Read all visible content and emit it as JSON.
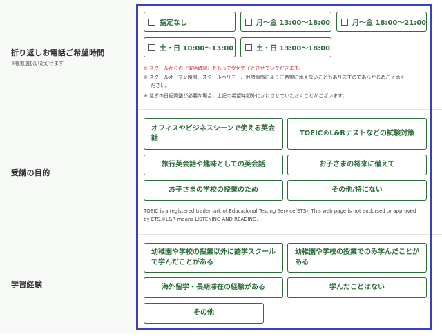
{
  "callback": {
    "label": "折り返しお電話ご希望時間",
    "sublabel": "※複数選択いただけます",
    "options": [
      "指定なし",
      "月〜金 13:00〜18:00",
      "月〜金 18:00〜21:00",
      "土・日 10:00〜13:00",
      "土・日 13:00〜18:00"
    ],
    "notes": [
      "※ スクールからの『電話確認』をもって受付完了とさせていただきます。",
      "※ スクールオープン時間、スクールホリデー、他諸事情によりご希望に添えないこともありますのであらかじめご了承く",
      "ださい。",
      "※ 急ぎの日程調整が必要な場合、上記の希望時間外にかけさせていただくことがございます。"
    ]
  },
  "purpose": {
    "label": "受講の目的",
    "options": [
      "オフィスやビジネスシーンで使える英会話",
      "TOEIC®L&Rテストなどの試験対策",
      "旅行英会話や趣味としての英会話",
      "お子さまの将来に備えて",
      "お子さまの学校の授業のため",
      "その他/特にない"
    ],
    "trademark": "TOEIC is a registered trademark of Educational Testing Service(ETS). This web page is not endorsed or approved by ETS.※L&R means LISTENING AND READING."
  },
  "experience": {
    "label": "学習経験",
    "options": [
      "幼稚園や学校の授業以外に語学スクールで学んだことがある",
      "幼稚園や学校の授業でのみ学んだことがある",
      "海外留学・長期滞在の経験がある",
      "学んだことはない",
      "その他"
    ]
  }
}
